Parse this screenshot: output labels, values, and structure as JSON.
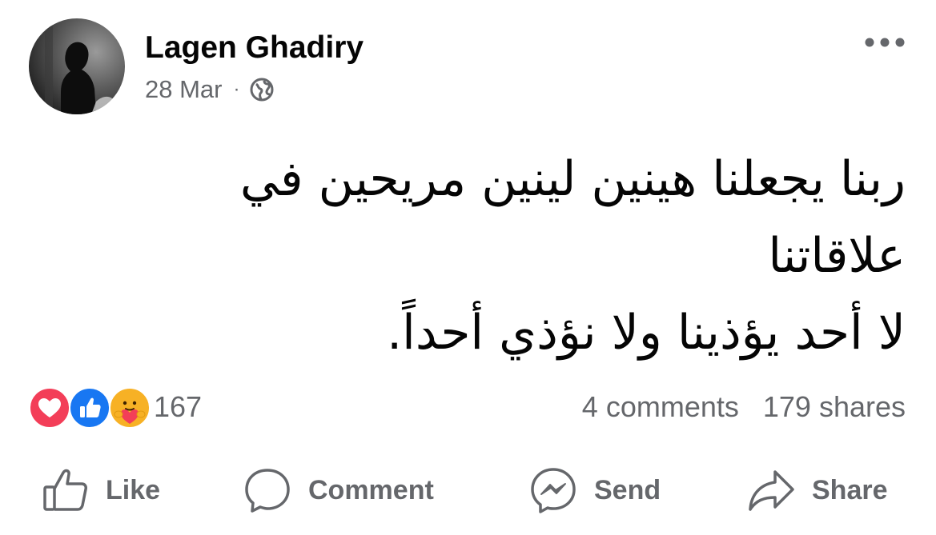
{
  "post": {
    "author": "Lagen Ghadiry",
    "date": "28 Mar",
    "separator": "·",
    "audience_icon": "globe-icon",
    "more_icon": "more-options-icon",
    "text_lines": [
      "ربنا يجعلنا هينين لينين مريحين في",
      "علاقاتنا",
      "لا أحد يؤذينا ولا نؤذي أحداً."
    ]
  },
  "engagement": {
    "reactions": [
      "love-reaction-icon",
      "like-reaction-icon",
      "care-reaction-icon"
    ],
    "reaction_count": "167",
    "comments": "4 comments",
    "shares": "179 shares"
  },
  "actions": {
    "like": "Like",
    "comment": "Comment",
    "send": "Send",
    "share": "Share"
  },
  "colors": {
    "text_primary": "#050505",
    "text_secondary": "#65676b",
    "like_blue": "#1877f2",
    "love_red": "#f33e58",
    "care_yellow": "#f7b125"
  }
}
